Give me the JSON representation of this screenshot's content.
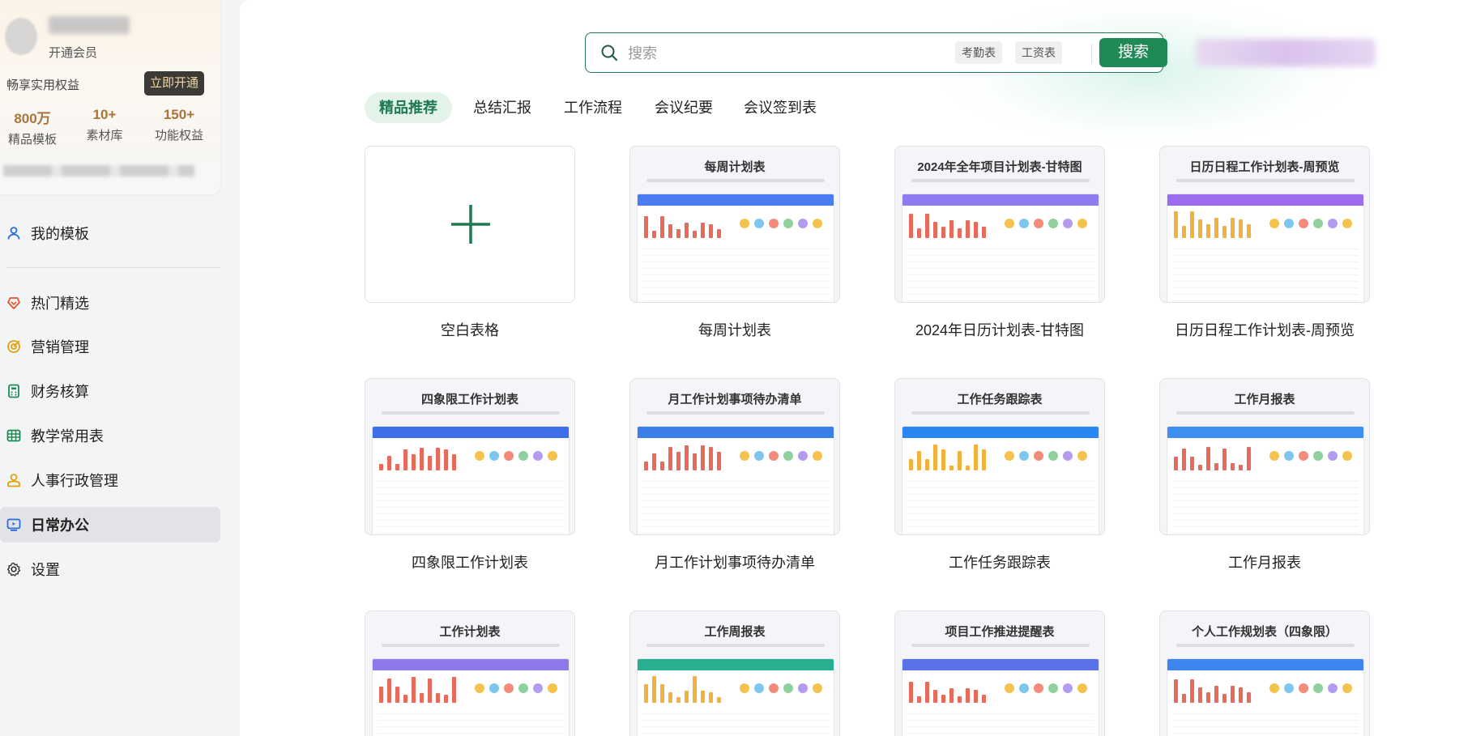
{
  "user": {
    "status": "开通会员",
    "perks_text": "畅享实用权益",
    "open_button": "立即开通",
    "stats": [
      {
        "num": "800万",
        "label": "精品模板"
      },
      {
        "num": "10+",
        "label": "素材库"
      },
      {
        "num": "150+",
        "label": "功能权益"
      }
    ]
  },
  "sidebar": {
    "my_templates": "我的模板",
    "items": [
      {
        "label": "热门精选",
        "icon": "heart-diamond-icon",
        "color": "#e4572e"
      },
      {
        "label": "营销管理",
        "icon": "target-icon",
        "color": "#e0a10b"
      },
      {
        "label": "财务核算",
        "icon": "calculator-icon",
        "color": "#1f8a55"
      },
      {
        "label": "教学常用表",
        "icon": "table-icon",
        "color": "#1f8a55"
      },
      {
        "label": "人事行政管理",
        "icon": "person-icon",
        "color": "#e0a10b"
      },
      {
        "label": "日常办公",
        "icon": "screen-icon",
        "color": "#2a6de0"
      },
      {
        "label": "设置",
        "icon": "gear-icon",
        "color": "#333333"
      }
    ]
  },
  "search": {
    "placeholder": "搜索",
    "chips": [
      "考勤表",
      "工资表"
    ],
    "button": "搜索"
  },
  "tabs": [
    "精品推荐",
    "总结汇报",
    "工作流程",
    "会议纪要",
    "会议签到表"
  ],
  "templates": [
    {
      "label": "空白表格",
      "thumb_title": "",
      "accent": "#1f7a50"
    },
    {
      "label": "每周计划表",
      "thumb_title": "每周计划表",
      "accent": "#4a7bf0"
    },
    {
      "label": "2024年日历计划表-甘特图",
      "thumb_title": "2024年全年项目计划表-甘特图",
      "accent": "#8c7cf0"
    },
    {
      "label": "日历日程工作计划表-周预览",
      "thumb_title": "日历日程工作计划表-周预览",
      "accent": "#9b6cf0"
    },
    {
      "label": "四象限工作计划表",
      "thumb_title": "四象限工作计划表",
      "accent": "#3f6fe8"
    },
    {
      "label": "月工作计划事项待办清单",
      "thumb_title": "月工作计划事项待办清单",
      "accent": "#3a7ee8"
    },
    {
      "label": "工作任务跟踪表",
      "thumb_title": "工作任务跟踪表",
      "accent": "#2a86f0"
    },
    {
      "label": "工作月报表",
      "thumb_title": "工作月报表",
      "accent": "#3e8ef0"
    },
    {
      "label": "",
      "thumb_title": "工作计划表",
      "accent": "#8f78ec"
    },
    {
      "label": "",
      "thumb_title": "工作周报表",
      "accent": "#26b08f"
    },
    {
      "label": "",
      "thumb_title": "项目工作推进提醒表",
      "accent": "#5a72e8"
    },
    {
      "label": "",
      "thumb_title": "个人工作规划表（四象限）",
      "accent": "#3d86f0"
    }
  ]
}
